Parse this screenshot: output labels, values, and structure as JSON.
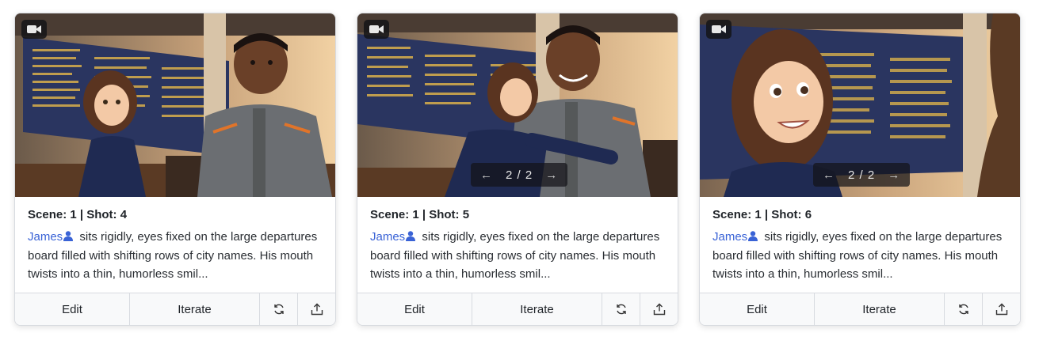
{
  "cards": [
    {
      "title": "Scene: 1 | Shot: 4",
      "character": "James",
      "description": "sits rigidly, eyes fixed on the large departures board filled with shifting rows of city names. His mouth twists into a thin, humorless smil...",
      "has_pager": false,
      "pager": "",
      "edit_label": "Edit",
      "iterate_label": "Iterate",
      "media_icon": "video-camera-icon"
    },
    {
      "title": "Scene: 1 | Shot: 5",
      "character": "James",
      "description": "sits rigidly, eyes fixed on the large departures board filled with shifting rows of city names. His mouth twists into a thin, humorless smil...",
      "has_pager": true,
      "pager": "2 / 2",
      "edit_label": "Edit",
      "iterate_label": "Iterate",
      "media_icon": "video-camera-icon"
    },
    {
      "title": "Scene: 1 | Shot: 6",
      "character": "James",
      "description": "sits rigidly, eyes fixed on the large departures board filled with shifting rows of city names. His mouth twists into a thin, humorless smil...",
      "has_pager": true,
      "pager": "2 / 2",
      "edit_label": "Edit",
      "iterate_label": "Iterate",
      "media_icon": "video-camera-icon"
    }
  ],
  "colors": {
    "link": "#3a63d6",
    "board": "#2a3560",
    "border": "#d8dbe0"
  }
}
